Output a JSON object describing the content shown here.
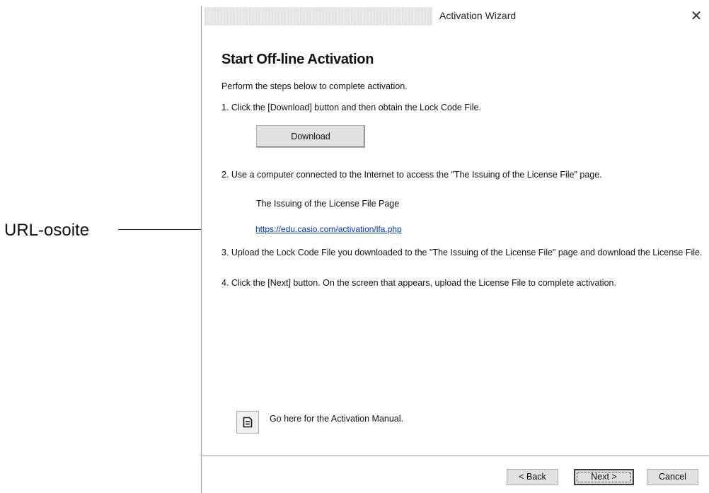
{
  "annotation": {
    "label": "URL-osoite"
  },
  "window": {
    "title": "Activation Wizard",
    "close_glyph": "✕"
  },
  "content": {
    "heading": "Start Off-line Activation",
    "intro": "Perform the steps below to complete activation.",
    "step1": "1. Click the [Download] button and then obtain the Lock Code File.",
    "download_label": "Download",
    "step2": "2. Use a computer connected to the Internet to access the \"The Issuing of the License File\" page.",
    "page_label": "The Issuing of the License File Page",
    "url": "https://edu.casio.com/activation/lfa.php",
    "step3": "3. Upload the Lock Code File you downloaded to the \"The Issuing of the License File\" page and download the License File.",
    "step4": "4. Click the [Next] button. On the screen that appears, upload the License File to complete activation.",
    "manual_text": "Go here for the Activation Manual.",
    "manual_icon": "document-icon"
  },
  "footer": {
    "back_label": "< Back",
    "next_label": "Next >",
    "cancel_label": "Cancel"
  }
}
